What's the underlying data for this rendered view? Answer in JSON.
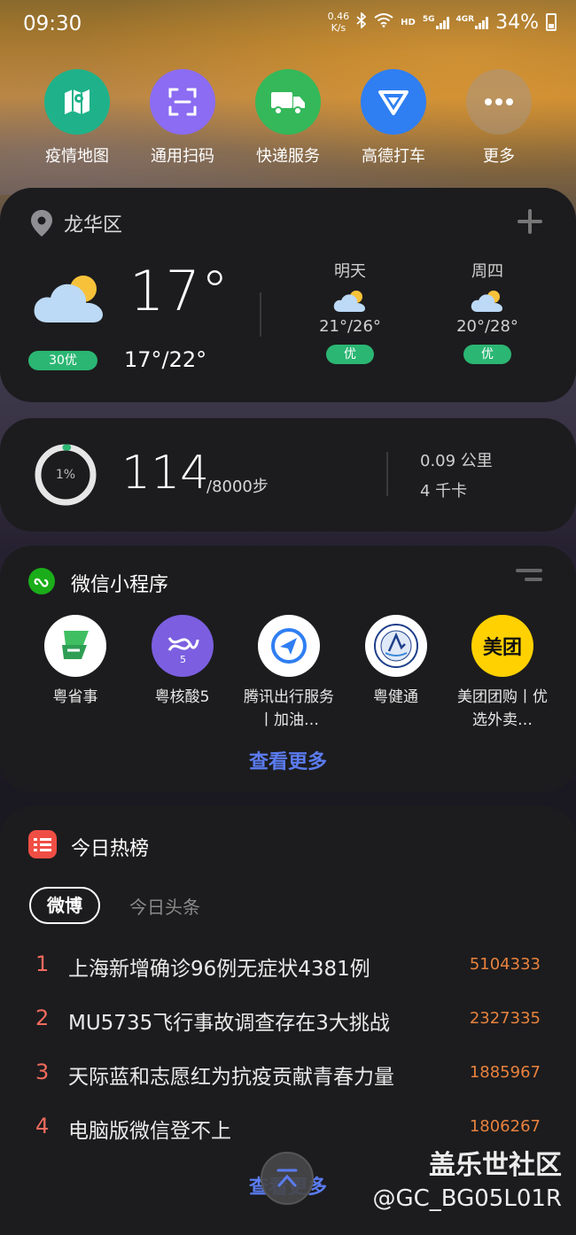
{
  "status_bar": {
    "time": "09:30",
    "net_speed_value": "0.46",
    "net_speed_unit": "K/s",
    "hd": "HD",
    "net_5g": "5G",
    "net_4g": "4GR",
    "battery": "34%"
  },
  "quick_actions": [
    {
      "label": "疫情地图",
      "icon": "map-icon",
      "color": "#1fb28a"
    },
    {
      "label": "通用扫码",
      "icon": "scan-icon",
      "color": "#8b6cf2"
    },
    {
      "label": "快递服务",
      "icon": "truck-icon",
      "color": "#34b85a"
    },
    {
      "label": "高德打车",
      "icon": "navigation-icon",
      "color": "#2f7ef2"
    },
    {
      "label": "更多",
      "icon": "more-icon",
      "color": "#8a7a6a"
    }
  ],
  "weather": {
    "district": "龙华区",
    "current_temp": "17°",
    "aqi": "30优",
    "range": "17°/22°",
    "forecast": [
      {
        "day": "明天",
        "range": "21°/26°",
        "quality": "优"
      },
      {
        "day": "周四",
        "range": "20°/28°",
        "quality": "优"
      }
    ]
  },
  "steps": {
    "percent": "1%",
    "progress": 0.014,
    "count": "114",
    "goal": "/8000步",
    "distance": "0.09 公里",
    "calories": "4 千卡"
  },
  "mini_programs": {
    "title": "微信小程序",
    "items": [
      {
        "name": "粤省事",
        "icon": "yueshengshi-icon"
      },
      {
        "name": "粤核酸5",
        "icon": "yuehesuan-icon"
      },
      {
        "name": "腾讯出行服务丨加油…",
        "icon": "tencent-travel-icon"
      },
      {
        "name": "粤健通",
        "icon": "yuejiantong-icon"
      },
      {
        "name": "美团团购丨优选外卖…",
        "icon": "meituan-icon",
        "logo_text": "美团"
      }
    ],
    "more": "查看更多"
  },
  "hot_list": {
    "title": "今日热榜",
    "tabs": [
      "微博",
      "今日头条"
    ],
    "items": [
      {
        "rank": "1",
        "text": "上海新增确诊96例无症状4381例",
        "count": "5104333"
      },
      {
        "rank": "2",
        "text": "MU5735飞行事故调查存在3大挑战",
        "count": "2327335"
      },
      {
        "rank": "3",
        "text": "天际蓝和志愿红为抗疫贡献青春力量",
        "count": "1885967"
      },
      {
        "rank": "4",
        "text": "电脑版微信登不上",
        "count": "1806267"
      }
    ],
    "more": "查看更多"
  },
  "watermark": {
    "line1": "盖乐世社区",
    "line2": "@GC_BG05L01R"
  }
}
